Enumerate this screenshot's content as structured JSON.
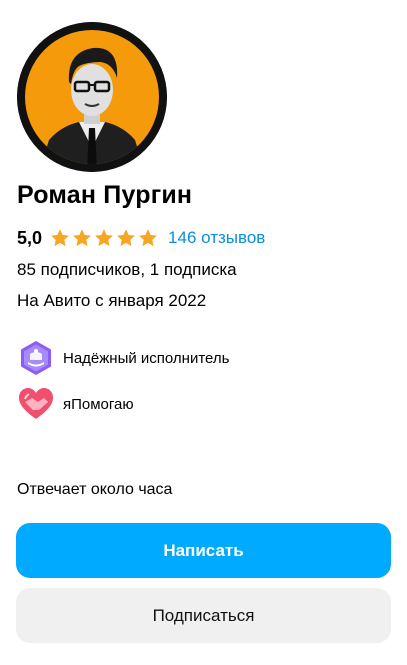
{
  "profile": {
    "name": "Роман Пургин",
    "rating": "5,0",
    "rating_stars": 5,
    "rating_star_color": "#f5a623",
    "reviews_link": "146 отзывов",
    "followers": "85 подписчиков, 1 подписка",
    "member_since": "На Авито с января 2022",
    "avatar_icon": "avatar-portrait",
    "avatar_bg_color": "#f59a0b"
  },
  "badges": [
    {
      "label": "Надёжный исполнитель",
      "icon": "reliable-executor-icon",
      "color": "#8b5cf6"
    },
    {
      "label": "яПомогаю",
      "icon": "heart-handshake-icon",
      "color": "#f0506e"
    }
  ],
  "response_time": "Отвечает около часа",
  "actions": {
    "write_label": "Написать",
    "write_color": "#00aaff",
    "subscribe_label": "Подписаться"
  }
}
